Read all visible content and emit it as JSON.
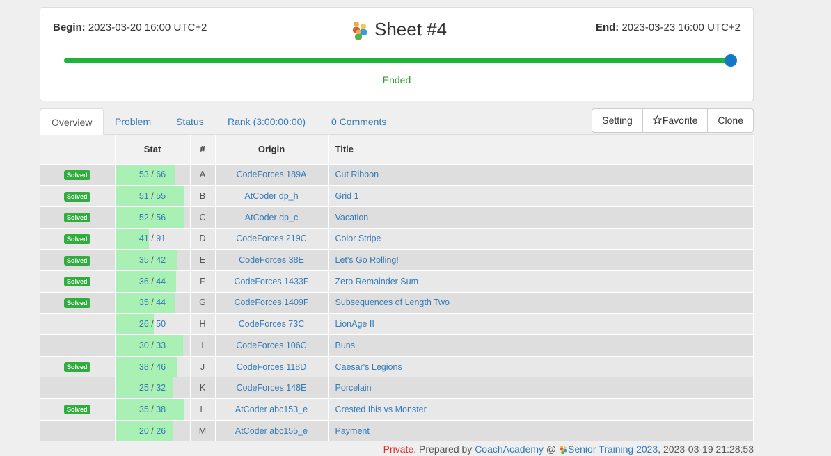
{
  "header": {
    "begin_label": "Begin:",
    "begin_value": "2023-03-20 16:00 UTC+2",
    "end_label": "End:",
    "end_value": "2023-03-23 16:00 UTC+2",
    "title": "Sheet #4",
    "progress_fraction": 1.0,
    "status": "Ended"
  },
  "tabs": [
    {
      "label": "Overview"
    },
    {
      "label": "Problem"
    },
    {
      "label": "Status"
    },
    {
      "label": "Rank (3:00:00:00)"
    },
    {
      "label": "0 Comments"
    }
  ],
  "buttons": {
    "setting": "Setting",
    "favorite": "Favorite",
    "clone": "Clone"
  },
  "table": {
    "headers": {
      "status": "",
      "stat": "Stat",
      "num": "#",
      "origin": "Origin",
      "title": "Title"
    },
    "rows": [
      {
        "status": "Solved",
        "solved": "53",
        "total": "66",
        "num": "A",
        "origin": "CodeForces 189A",
        "title": "Cut Ribbon"
      },
      {
        "status": "Solved",
        "solved": "51",
        "total": "55",
        "num": "B",
        "origin": "AtCoder dp_h",
        "title": "Grid 1"
      },
      {
        "status": "Solved",
        "solved": "52",
        "total": "56",
        "num": "C",
        "origin": "AtCoder dp_c",
        "title": "Vacation"
      },
      {
        "status": "Solved",
        "solved": "41",
        "total": "91",
        "num": "D",
        "origin": "CodeForces 219C",
        "title": "Color Stripe"
      },
      {
        "status": "Solved",
        "solved": "35",
        "total": "42",
        "num": "E",
        "origin": "CodeForces 38E",
        "title": "Let's Go Rolling!"
      },
      {
        "status": "Solved",
        "solved": "36",
        "total": "44",
        "num": "F",
        "origin": "CodeForces 1433F",
        "title": "Zero Remainder Sum"
      },
      {
        "status": "Solved",
        "solved": "35",
        "total": "44",
        "num": "G",
        "origin": "CodeForces 1409F",
        "title": "Subsequences of Length Two"
      },
      {
        "status": "",
        "solved": "26",
        "total": "50",
        "num": "H",
        "origin": "CodeForces 73C",
        "title": "LionAge II"
      },
      {
        "status": "",
        "solved": "30",
        "total": "33",
        "num": "I",
        "origin": "CodeForces 106C",
        "title": "Buns"
      },
      {
        "status": "Solved",
        "solved": "38",
        "total": "46",
        "num": "J",
        "origin": "CodeForces 118D",
        "title": "Caesar's Legions"
      },
      {
        "status": "",
        "solved": "25",
        "total": "32",
        "num": "K",
        "origin": "CodeForces 148E",
        "title": "Porcelain"
      },
      {
        "status": "Solved",
        "solved": "35",
        "total": "38",
        "num": "L",
        "origin": "AtCoder abc153_e",
        "title": "Crested Ibis vs Monster"
      },
      {
        "status": "",
        "solved": "20",
        "total": "26",
        "num": "M",
        "origin": "AtCoder abc155_e",
        "title": "Payment"
      }
    ]
  },
  "footer": {
    "private": "Private",
    "prepared_by": ". Prepared by ",
    "author": "CoachAcademy",
    "at": " @ ",
    "group": "Senior Training 2023",
    "timestamp": ", 2023-03-19 21:28:53"
  },
  "colors": {
    "accent": "#337ab7",
    "progress": "#1eb43c",
    "knob": "#1478c8",
    "solved_badge": "#2fae3c",
    "stat_bar": "#a8f0b4",
    "private": "#d9302a"
  },
  "icons": {
    "title_icon": "people-group-icon",
    "favorite_icon": "star-outline-icon",
    "footer_icon": "people-group-icon"
  }
}
